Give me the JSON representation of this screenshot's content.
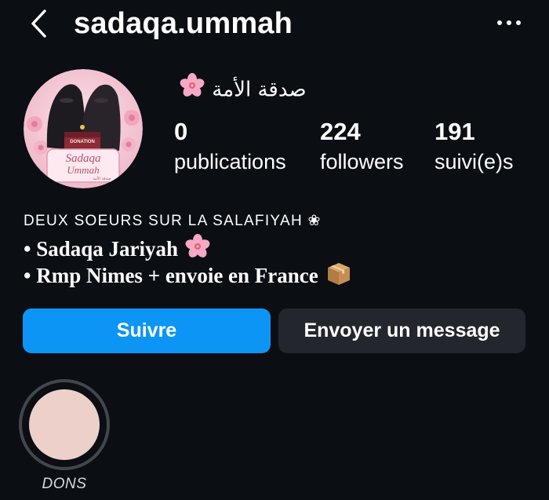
{
  "header": {
    "username": "sadaqa.ummah",
    "back_icon": "chevron-left-icon",
    "more_icon": "more-horizontal-icon"
  },
  "profile": {
    "display_name": "صدقة الأمة",
    "display_name_icon": "cherry-blossom-emoji",
    "avatar": {
      "text_main": "Sadaqa",
      "text_sub": "Ummah",
      "text_arabic": "صدقة الأمة",
      "box_label": "DONATION"
    },
    "stats": [
      {
        "value": "0",
        "label": "publications"
      },
      {
        "value": "224",
        "label": "followers"
      },
      {
        "value": "191",
        "label": "suivi(e)s"
      }
    ]
  },
  "bio": {
    "line1": "DEUX SOEURS SUR LA SALAFIYAH ❀",
    "line2": "• Sadaqa Jariyah",
    "line2_icon": "cherry-blossom-emoji",
    "line3": "• Rmp Nimes + envoie en France",
    "line3_icon": "package-emoji"
  },
  "actions": {
    "follow_label": "Suivre",
    "message_label": "Envoyer un message"
  },
  "highlights": [
    {
      "label": "DONS"
    }
  ],
  "colors": {
    "background": "#0b0e13",
    "follow_button": "#0d95f5",
    "message_button": "#23262d",
    "highlight_fill": "#edd0c9"
  }
}
